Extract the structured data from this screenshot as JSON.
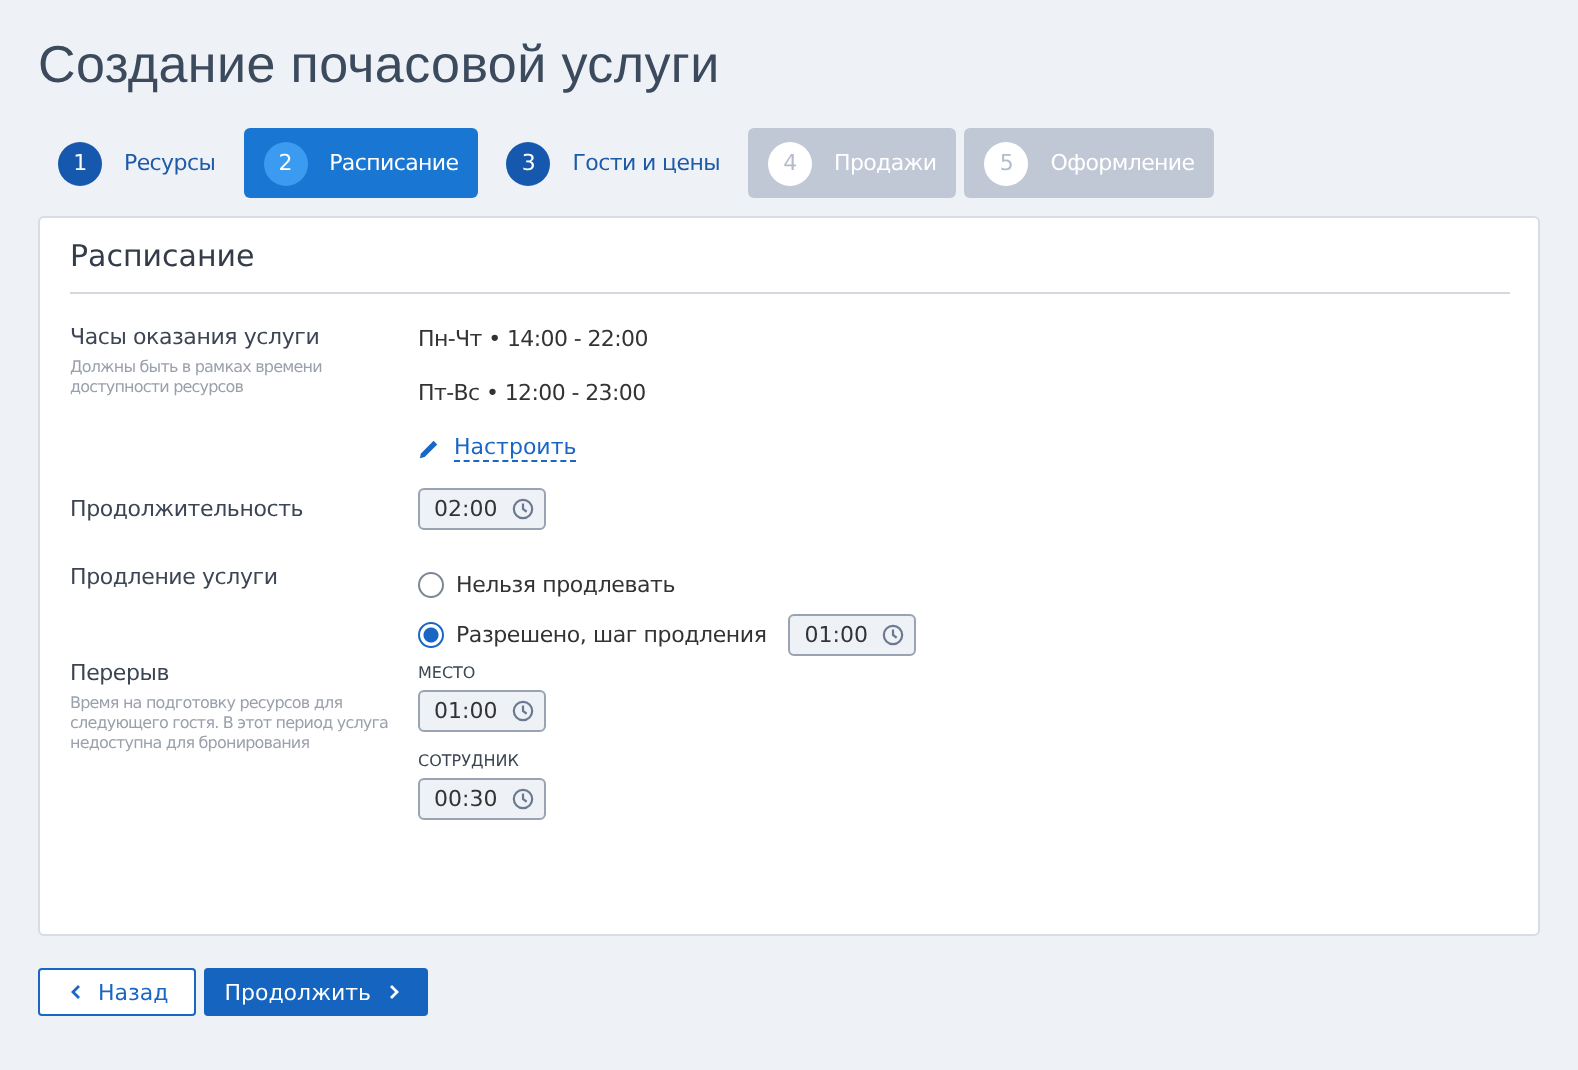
{
  "page_title": "Создание почасовой услуги",
  "steps": [
    {
      "number": "1",
      "label": "Ресурсы",
      "selected": false,
      "disabled": false
    },
    {
      "number": "2",
      "label": "Расписание",
      "selected": true,
      "disabled": false
    },
    {
      "number": "3",
      "label": "Гости и цены",
      "selected": false,
      "disabled": false
    },
    {
      "number": "4",
      "label": "Продажи",
      "selected": false,
      "disabled": true
    },
    {
      "number": "5",
      "label": "Оформление",
      "selected": false,
      "disabled": true
    }
  ],
  "card": {
    "title": "Расписание",
    "hours": {
      "label": "Часы оказания услуги",
      "hint": "Должны быть в рамках времени доступности ресурсов",
      "schedule": [
        "Пн-Чт • 14:00 - 22:00",
        "Пт-Вс • 12:00 - 23:00"
      ],
      "configure_link": "Настроить"
    },
    "duration": {
      "label": "Продолжительность",
      "value": "02:00"
    },
    "extension": {
      "label": "Продление услуги",
      "options": [
        {
          "label": "Нельзя продлевать",
          "selected": false
        },
        {
          "label": "Разрешено, шаг продления",
          "selected": true,
          "value": "01:00"
        }
      ]
    },
    "break": {
      "label": "Перерыв",
      "hint": "Время на подготовку ресурсов для следующего гостя. В этот период услуга недоступна для бронирования",
      "fields": [
        {
          "label": "МЕСТО",
          "value": "01:00"
        },
        {
          "label": "СОТРУДНИК",
          "value": "00:30"
        }
      ]
    }
  },
  "buttons": {
    "back": "Назад",
    "next": "Продолжить"
  }
}
